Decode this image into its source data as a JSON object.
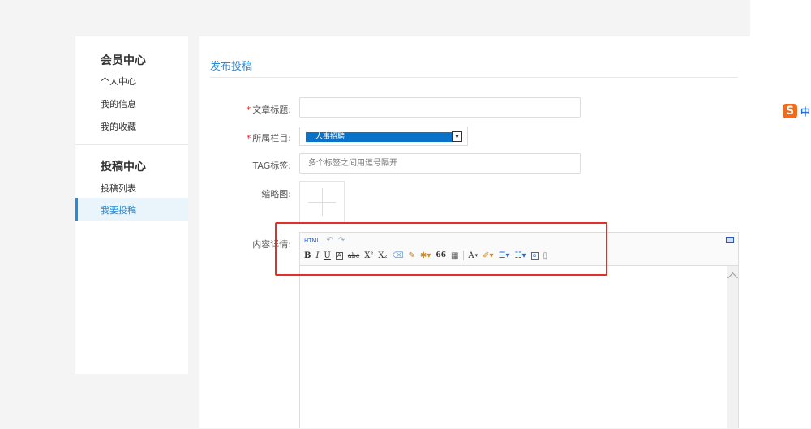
{
  "sidebar": {
    "sections": [
      {
        "title": "会员中心",
        "items": [
          "个人中心",
          "我的信息",
          "我的收藏"
        ]
      },
      {
        "title": "投稿中心",
        "items": [
          "投稿列表",
          "我要投稿"
        ]
      }
    ],
    "active_item": "我要投稿"
  },
  "main": {
    "page_title": "发布投稿",
    "form": {
      "title_label": "文章标题:",
      "title_value": "",
      "column_label": "所属栏目:",
      "column_selected": "人事招聘",
      "tag_label": "TAG标签:",
      "tag_placeholder": "多个标签之间用逗号隔开",
      "thumb_label": "缩略图:",
      "content_label": "内容详情:"
    }
  },
  "editor": {
    "toolbar_row1": {
      "html_label": "HTML"
    },
    "toolbar_row2": {
      "bold": "B",
      "italic": "I",
      "underline": "U",
      "box_a": "A",
      "strike": "abc",
      "superscript": "X²",
      "subscript": "X₂",
      "quote": "66",
      "font_color": "A",
      "box_small_a": "a"
    }
  },
  "ime": {
    "label": "中"
  },
  "colors": {
    "accent": "#2a8ad8",
    "required": "#e02020",
    "highlight_box": "#e0302a",
    "select_fill": "#0a72c8"
  }
}
